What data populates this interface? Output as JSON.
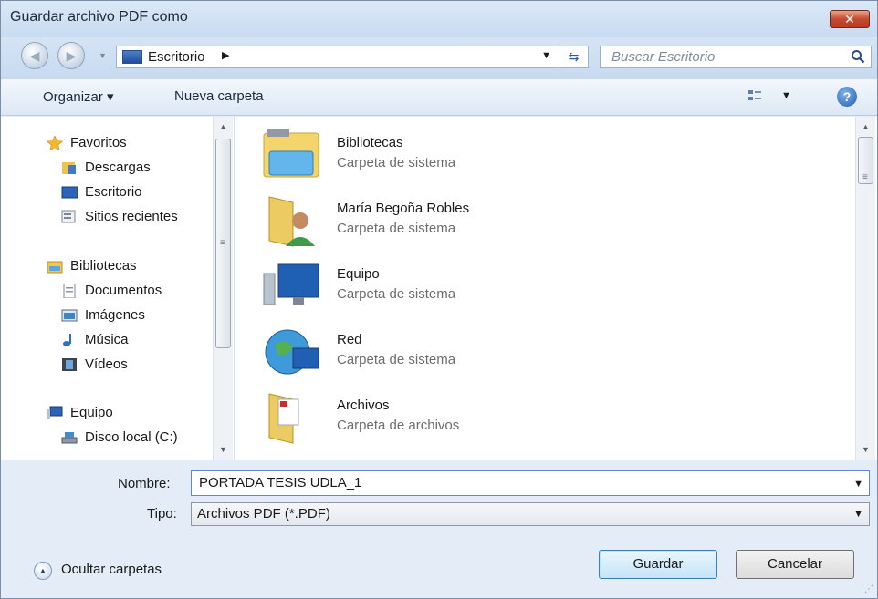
{
  "window": {
    "title": "Guardar archivo PDF como",
    "close_glyph": "✕"
  },
  "address": {
    "back_glyph": "◀",
    "forward_glyph": "▶",
    "current_location": "Escritorio",
    "breadcrumb_arrow": "▶",
    "dropdown_glyph": "▼",
    "refresh_glyph": "⇆",
    "location_icon": "desktop-icon"
  },
  "search": {
    "placeholder": "Buscar Escritorio",
    "icon": "search-icon"
  },
  "toolbar": {
    "organize_label": "Organizar ▾",
    "new_folder_label": "Nueva carpeta",
    "views_dropdown": "▼",
    "help_glyph": "?"
  },
  "nav": {
    "items": [
      {
        "label": "Favoritos",
        "icon": "star-icon"
      },
      {
        "label": "Descargas",
        "icon": "downloads-icon"
      },
      {
        "label": "Escritorio",
        "icon": "desktop-icon"
      },
      {
        "label": "Sitios recientes",
        "icon": "recent-places-icon"
      },
      {
        "label": "Bibliotecas",
        "icon": "libraries-icon"
      },
      {
        "label": "Documentos",
        "icon": "documents-icon"
      },
      {
        "label": "Imágenes",
        "icon": "pictures-icon"
      },
      {
        "label": "Música",
        "icon": "music-icon"
      },
      {
        "label": "Vídeos",
        "icon": "videos-icon"
      },
      {
        "label": "Equipo",
        "icon": "computer-icon"
      },
      {
        "label": "Disco local (C:)",
        "icon": "drive-icon"
      }
    ]
  },
  "files": [
    {
      "name": "Bibliotecas",
      "type": "Carpeta de sistema",
      "icon": "libraries-folder-icon"
    },
    {
      "name": "María Begoña Robles",
      "type": "Carpeta de sistema",
      "icon": "user-folder-icon"
    },
    {
      "name": "Equipo",
      "type": "Carpeta de sistema",
      "icon": "computer-icon"
    },
    {
      "name": "Red",
      "type": "Carpeta de sistema",
      "icon": "network-icon"
    },
    {
      "name": "Archivos",
      "type": "Carpeta de archivos",
      "icon": "folder-icon"
    }
  ],
  "form": {
    "name_label": "Nombre:",
    "name_value": "PORTADA TESIS UDLA_1",
    "type_label": "Tipo:",
    "type_value": "Archivos PDF (*.PDF)"
  },
  "footer": {
    "hide_folders_label": "Ocultar carpetas",
    "save_label": "Guardar",
    "cancel_label": "Cancelar"
  },
  "colors": {
    "title_bar": "#c9dbf1",
    "close_button": "#c44a30",
    "accent": "#1f5fb4"
  }
}
